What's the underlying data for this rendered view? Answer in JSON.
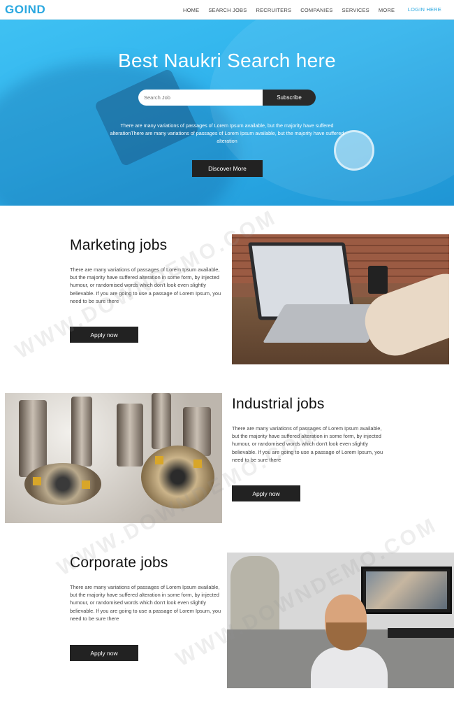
{
  "brand": {
    "logo": "GOIND",
    "accent": "#2ba8e0"
  },
  "nav": {
    "items": [
      "HOME",
      "SEARCH JOBS",
      "RECRUITERS",
      "COMPANIES",
      "SERVICES",
      "MORE"
    ],
    "login": "LOGIN HERE"
  },
  "hero": {
    "title": "Best Naukri Search here",
    "search_placeholder": "Search Job",
    "subscribe_label": "Subscribe",
    "description": "There are many variations of passages of Lorem Ipsum available, but the majority have suffered alterationThere are many variations of passages of Lorem Ipsum available, but the majority have suffered alteration",
    "discover_label": "Discover More"
  },
  "jobs": [
    {
      "title": "Marketing jobs",
      "text": "There are many variations of passages of Lorem Ipsum available, but the majority have suffered alteration in some form, by injected humour, or randomised words which don't look even slightly believable. If you are going to use a passage of Lorem Ipsum, you need to be sure there",
      "apply_label": "Apply now"
    },
    {
      "title": "Industrial jobs",
      "text": "There are many variations of passages of Lorem Ipsum available, but the majority have suffered alteration in some form, by injected humour, or randomised words which don't look even slightly believable. If you are going to use a passage of Lorem Ipsum, you need to be sure there",
      "apply_label": "Apply now"
    },
    {
      "title": "Corporate jobs",
      "text": "There are many variations of passages of Lorem Ipsum available, but the majority have suffered alteration in some form, by injected humour, or randomised words which don't look even slightly believable. If you are going to use a passage of Lorem Ipsum, you need to be sure there",
      "apply_label": "Apply now"
    }
  ],
  "watermark": "WWW.DOWNDEMO.COM"
}
